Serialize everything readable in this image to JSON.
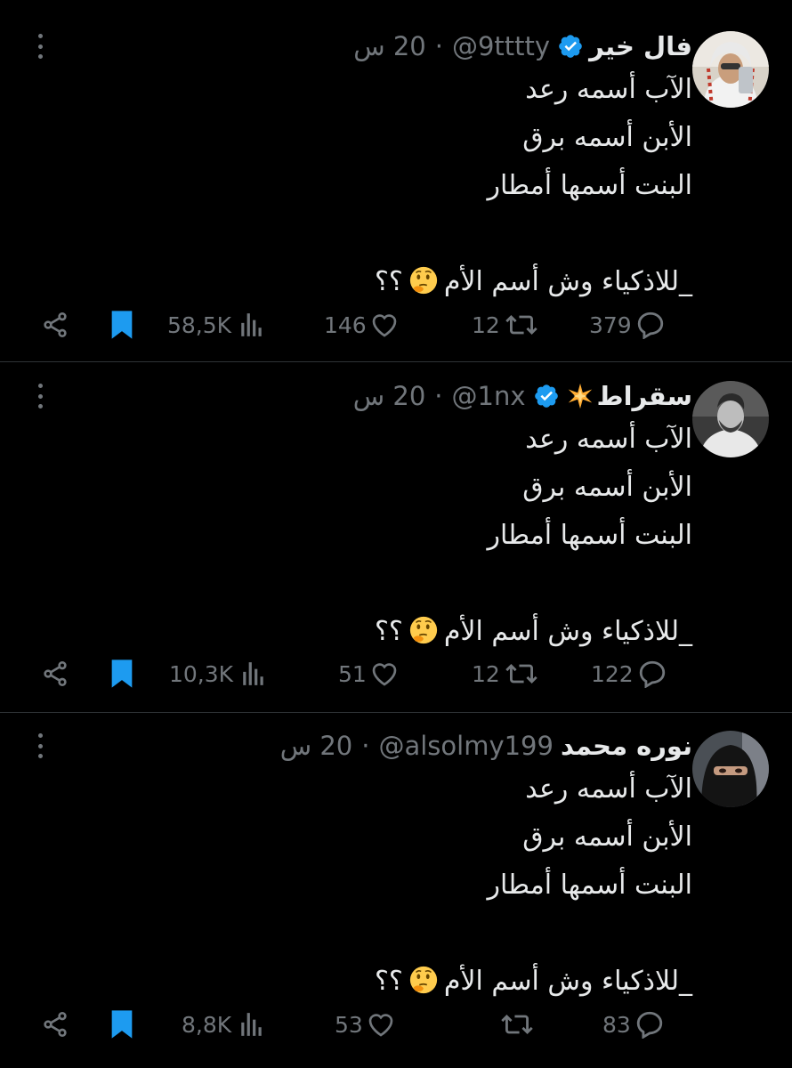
{
  "tweets": [
    {
      "name": "فال خير",
      "handle": "@9tttty",
      "time": "20 س",
      "verified": true,
      "lines": [
        "الآب أسمه رعد",
        "الأبن أسمه برق",
        "البنت أسمها أمطار",
        "",
        "_للاذكياء وش  أسم الأم"
      ],
      "question_marks": "؟؟",
      "stats": {
        "views": "58,5K",
        "likes": "146",
        "retweets": "12",
        "replies": "379"
      }
    },
    {
      "name": "سقراط",
      "handle": "@1nx",
      "time": "20 س",
      "verified": true,
      "lines": [
        "الآب أسمه رعد",
        "الأبن أسمه برق",
        "البنت أسمها أمطار",
        "",
        "_للاذكياء وش  أسم الأم"
      ],
      "question_marks": "؟؟",
      "stats": {
        "views": "10,3K",
        "likes": "51",
        "retweets": "12",
        "replies": "122"
      }
    },
    {
      "name": "نوره محمد",
      "handle": "@alsolmy199",
      "time": "20 س",
      "verified": false,
      "lines": [
        "الآب أسمه رعد",
        "الأبن أسمه برق",
        "البنت أسمها أمطار",
        "",
        "_للاذكياء وش  أسم الأم"
      ],
      "question_marks": "؟؟",
      "stats": {
        "views": "8,8K",
        "likes": "53",
        "retweets": "",
        "replies": "83"
      }
    }
  ],
  "icons": {
    "more": "more-icon",
    "verified": "verified-badge-icon",
    "share": "share-icon",
    "bookmark": "bookmark-icon",
    "views": "views-icon",
    "like": "heart-icon",
    "retweet": "retweet-icon",
    "reply": "reply-icon",
    "thinking": "thinking-face-emoji",
    "sparkle": "glowing-star-emoji"
  },
  "colors": {
    "background": "#000000",
    "text": "#e7e9ea",
    "muted": "#71767b",
    "accent": "#1d9bf0",
    "divider": "#2f3336"
  }
}
